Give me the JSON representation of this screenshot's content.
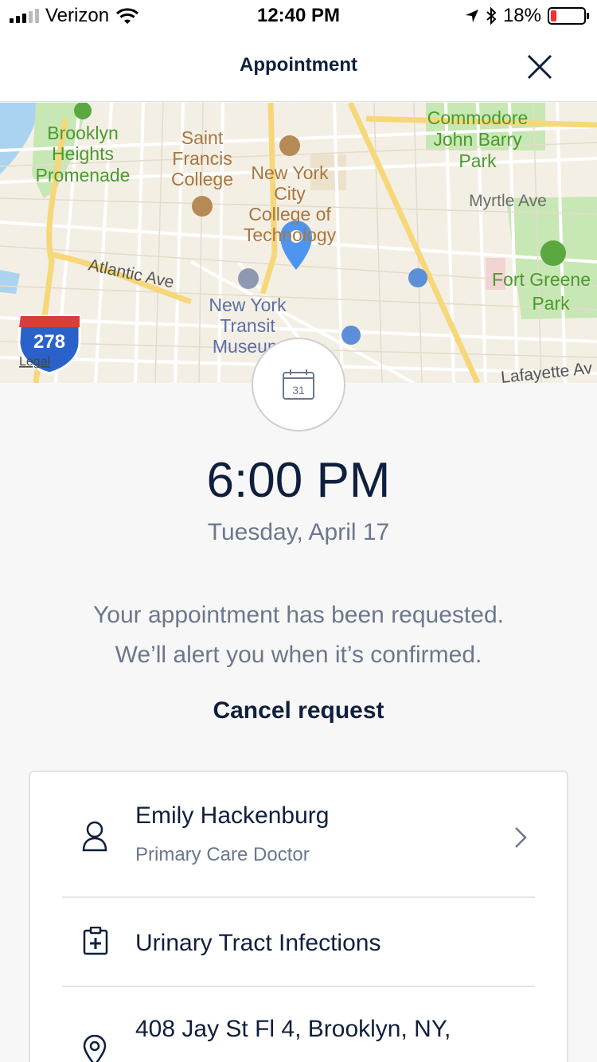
{
  "status_bar": {
    "carrier": "Verizon",
    "time": "12:40 PM",
    "battery": "18%",
    "battery_level": 0.18
  },
  "nav": {
    "title": "Appointment"
  },
  "map": {
    "labels": {
      "brooklyn_1": "Brooklyn",
      "brooklyn_2": "Heights",
      "brooklyn_3": "Promenade",
      "sfc_1": "Saint",
      "sfc_2": "Francis",
      "sfc_3": "College",
      "nyc_1": "New York",
      "nyc_2": "City",
      "nyc_3": "College of",
      "nyc_4": "Technology",
      "commodore_1": "Commodore",
      "commodore_2": "John Barry",
      "commodore_3": "Park",
      "myrtle": "Myrtle Ave",
      "atlantic": "Atlantic Ave",
      "transit_1": "New York",
      "transit_2": "Transit",
      "transit_3": "Museum",
      "fortgreene_1": "Fort Greene",
      "fortgreene_2": "Park",
      "lafayette": "Lafayette Av",
      "highway": "278",
      "legal": "Legal"
    }
  },
  "calendar_icon_day": "31",
  "appointment": {
    "time": "6:00 PM",
    "date": "Tuesday, April 17",
    "message_line1": "Your appointment has been requested.",
    "message_line2": "We’ll alert you when it’s confirmed.",
    "cancel_label": "Cancel request"
  },
  "details": {
    "doctor_name": "Emily Hackenburg",
    "doctor_role": "Primary Care Doctor",
    "reason": "Urinary Tract Infections",
    "address": "408 Jay St Fl 4, Brooklyn, NY,"
  }
}
